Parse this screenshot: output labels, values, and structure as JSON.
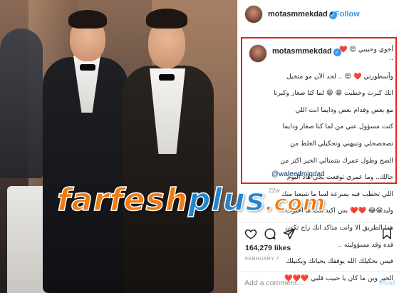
{
  "post": {
    "username": "motasmmekdad",
    "verified": true,
    "follow_label": "Follow",
    "bullet": "•",
    "caption_lines": [
      "أخوي وحبيبي 😍 ❤️ ..",
      "وأسطورتي ❤️ 😍 .. لحد الآن مو متخيل",
      "انك كبرت وخطبت 😁 😁 لما كنا صغار وكبرنا",
      "مع بعض وقدام بعض ودايما انت اللي",
      "كنت مسؤول عني من لما كنا صغار ودايما",
      "تصحصحلي وتنبهني وتحكيلي الغلط من",
      "الصح وطول عمرك بتتمنالي الخير اكتر من",
      "حالك.. وما عمري توقعت يجي هاد اليوم",
      "اللي تخطب فيه بسرعة لسا ما شبعنا منك",
      "وليد😁😂 ❤️❤️ بس اكيد انت ما اخترت",
      "هذا الطريق الا وانت متاكد انك راح تكون",
      "قده وقد مسؤوليته ..",
      "فيس بحكيلك الله يوفقك بحياتك ويكتبلك",
      "الخير وين ما كان يا حبيب قلبي ❤️❤️❤️"
    ],
    "mention": "@waleedmiqdad",
    "caption_time": "22w",
    "likes": "164,279 likes",
    "date": "FEBRUARY 7",
    "comment_placeholder": "Add a comment...",
    "post_label": "Post"
  },
  "watermark": {
    "part1": "farfesh",
    "part2": "plus",
    "part3": ".com"
  },
  "colors": {
    "accent": "#3897f0",
    "highlight_border": "#e0241f",
    "watermark_orange": "#f07b10",
    "watermark_blue": "#1f86d0"
  },
  "icons": [
    "verified-icon",
    "heart-icon",
    "comment-icon",
    "share-icon",
    "bookmark-icon"
  ]
}
